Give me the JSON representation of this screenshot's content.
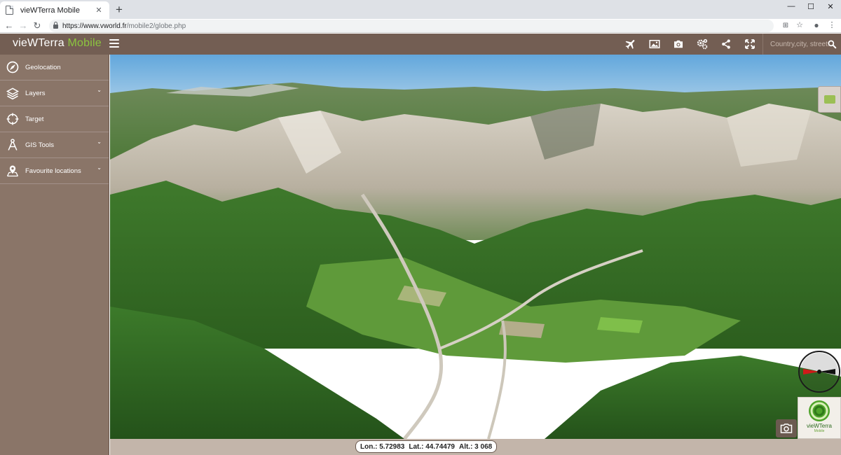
{
  "browser": {
    "tab_title": "vieWTerra Mobile",
    "tab_close": "✕",
    "new_tab": "+",
    "url_host": "https://www.vworld.fr",
    "url_path": "/mobile2/globe.php",
    "window_minimize": "—",
    "window_maximize": "☐",
    "window_close": "✕"
  },
  "app": {
    "logo_main": "vieWTerra",
    "logo_accent": "Mobile",
    "search_placeholder": "Country,city, street..",
    "colors": {
      "header": "#735e53",
      "sidebar": "#8a7568",
      "accent": "#8cc63f"
    }
  },
  "toolbar": [
    {
      "name": "airplane-icon"
    },
    {
      "name": "image-icon"
    },
    {
      "name": "camera-icon"
    },
    {
      "name": "settings-icon"
    },
    {
      "name": "share-icon"
    },
    {
      "name": "fullscreen-icon"
    }
  ],
  "sidebar": {
    "items": [
      {
        "label": "Geolocation",
        "icon": "compass-icon",
        "expandable": false
      },
      {
        "label": "Layers",
        "icon": "layers-icon",
        "expandable": true
      },
      {
        "label": "Target",
        "icon": "target-icon",
        "expandable": false
      },
      {
        "label": "GIS Tools",
        "icon": "gis-tools-icon",
        "expandable": true
      },
      {
        "label": "Favourite locations",
        "icon": "map-pin-icon",
        "expandable": true
      }
    ],
    "chevron": "⌄"
  },
  "status": {
    "lon": "Lon.: 5.72983",
    "lat": "Lat.: 44.74479",
    "alt": "Alt.: 3 068"
  }
}
